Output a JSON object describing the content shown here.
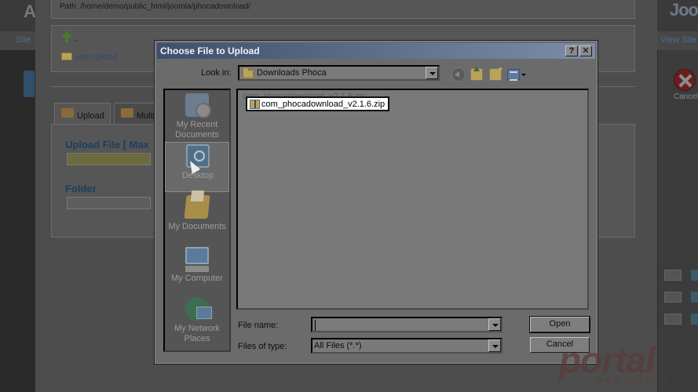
{
  "background": {
    "logo_left": "A",
    "logo_right": "Joo",
    "nav_left": "Site",
    "nav_right": "View Site",
    "path": "Path: /home/demo/public_html/joomla/phocadownload/",
    "parent_dir": "..",
    "folders": [
      "userupload"
    ],
    "tabs": [
      {
        "label": "Upload"
      },
      {
        "label": "Multi"
      }
    ],
    "upload_title": "Upload File [ Max",
    "folder_title": "Folder",
    "cancel_label": "Cancel"
  },
  "dialog": {
    "title": "Choose File to Upload",
    "help_button": "?",
    "close_button": "✕",
    "look_in_label": "Look in:",
    "look_in_value": "Downloads Phoca",
    "places": [
      {
        "label": "My Recent Documents",
        "icon": "recent-documents-icon"
      },
      {
        "label": "Desktop",
        "icon": "desktop-icon"
      },
      {
        "label": "My Documents",
        "icon": "my-documents-icon"
      },
      {
        "label": "My Computer",
        "icon": "my-computer-icon"
      },
      {
        "label": "My Network Places",
        "icon": "network-places-icon"
      }
    ],
    "files": [
      {
        "name": "com_phocadownload_v2.1.6.zip"
      }
    ],
    "ghost_file": "com_phocadownload_v2.1.6.zip",
    "file_name_label": "File name:",
    "file_name_value": "",
    "files_of_type_label": "Files of type:",
    "files_of_type_value": "All Files (*.*)",
    "open_button": "Open",
    "cancel_button": "Cancel"
  },
  "watermark": {
    "text": "portal",
    "subtext": "web hosting"
  },
  "colors": {
    "title_gradient_start": "#3e4f6f",
    "title_gradient_end": "#7d8ca8",
    "dialog_bg": "#6b6b6b",
    "link": "#2f4f70"
  }
}
